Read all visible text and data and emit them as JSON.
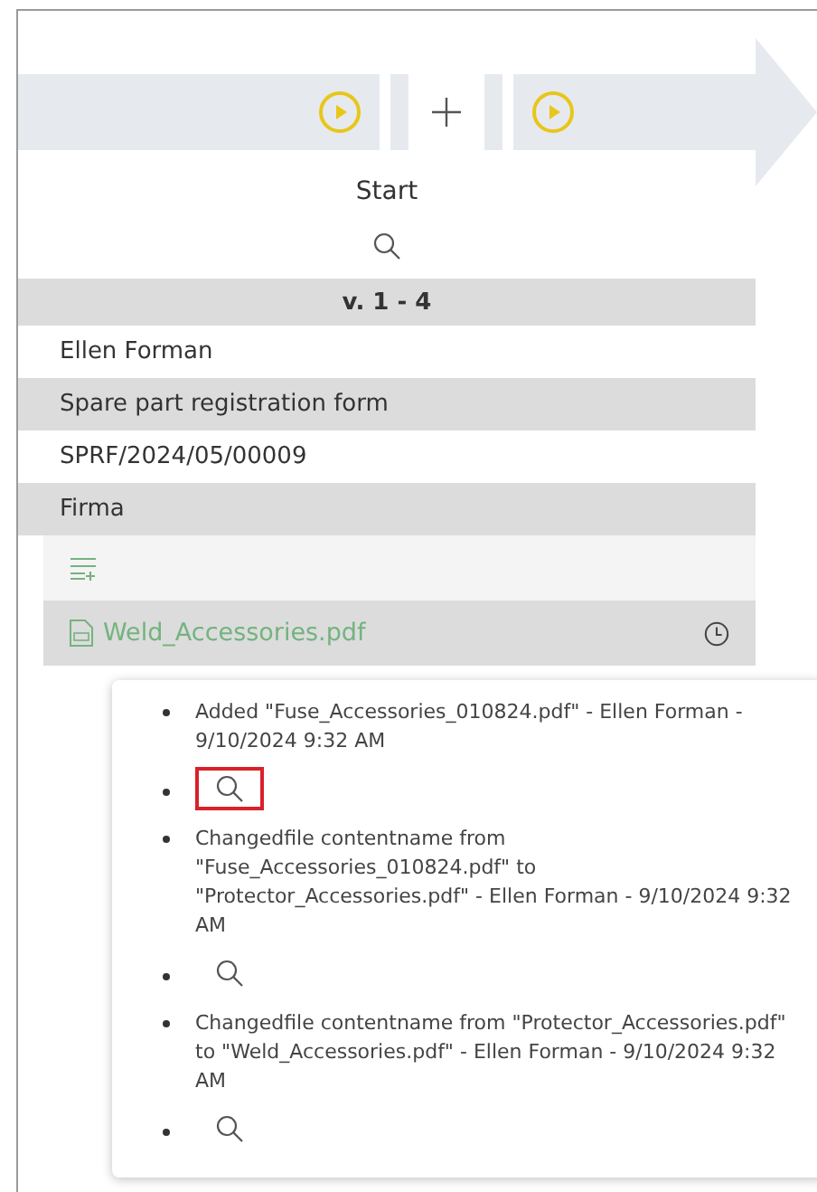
{
  "stage": {
    "label": "Start"
  },
  "version": {
    "label": "v. 1 - 4"
  },
  "fields": [
    {
      "value": "Ellen Forman",
      "shaded": false
    },
    {
      "value": "Spare part registration form",
      "shaded": true
    },
    {
      "value": "SPRF/2024/05/00009",
      "shaded": false
    },
    {
      "value": "Firma",
      "shaded": true
    }
  ],
  "attachment": {
    "file_name": "Weld_Accessories.pdf"
  },
  "history": [
    {
      "kind": "entry",
      "text": "Added \"Fuse_Accessories_010824.pdf\" - Ellen Forman - 9/10/2024 9:32 AM"
    },
    {
      "kind": "view",
      "highlighted": true
    },
    {
      "kind": "entry",
      "text": "Changedfile contentname from \"Fuse_Accessories_010824.pdf\" to \"Protector_Accessories.pdf\" - Ellen Forman - 9/10/2024 9:32 AM"
    },
    {
      "kind": "view",
      "highlighted": false
    },
    {
      "kind": "entry",
      "text": "Changedfile contentname from \"Protector_Accessories.pdf\" to \"Weld_Accessories.pdf\" - Ellen Forman - 9/10/2024 9:32 AM"
    },
    {
      "kind": "view",
      "highlighted": false
    }
  ]
}
